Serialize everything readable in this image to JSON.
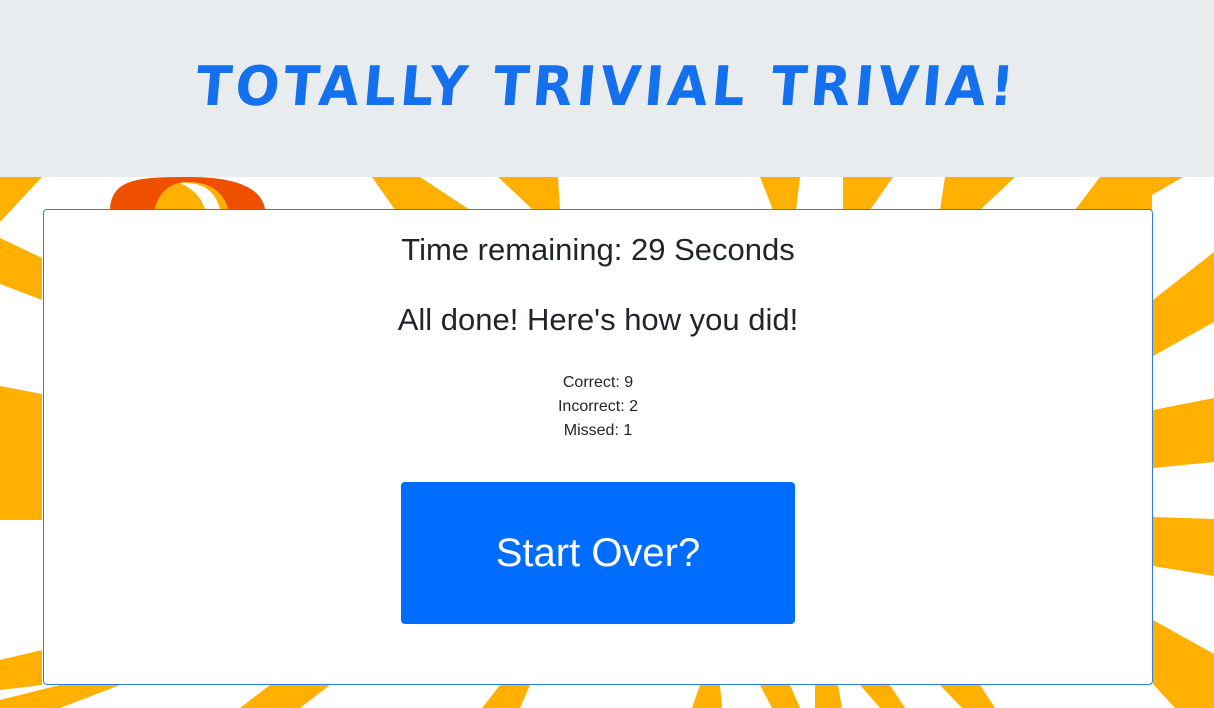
{
  "header": {
    "title": "Totally Trivial Trivia!"
  },
  "game": {
    "timer_text": "Time remaining: 29 Seconds",
    "done_heading": "All done! Here's how you did!",
    "stats": {
      "correct": "Correct: 9",
      "incorrect": "Incorrect: 2",
      "missed": "Missed: 1"
    },
    "start_over_label": "Start Over?"
  },
  "colors": {
    "title": "#1470ec",
    "header_bg": "#e9ecef",
    "button_bg": "#006dff",
    "card_border": "#2f7fe0",
    "sunburst_ray": "#ffb000",
    "sunburst_accent": "#ee5000"
  }
}
